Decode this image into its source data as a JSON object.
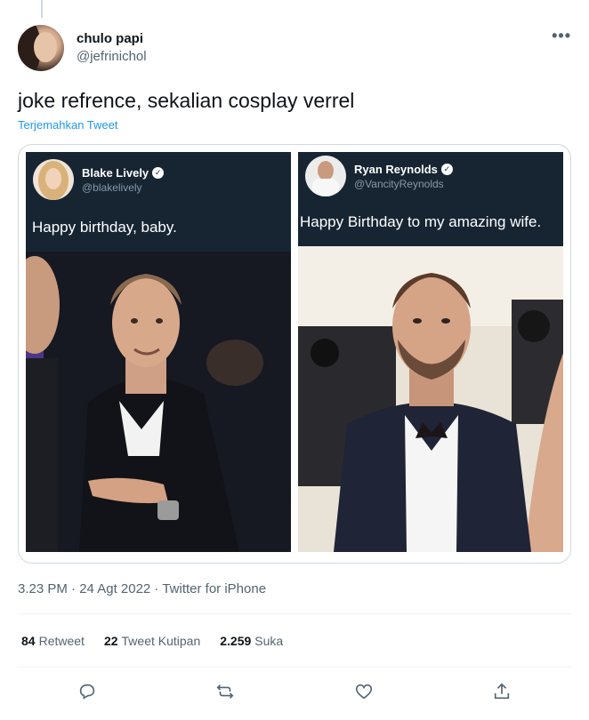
{
  "tweet": {
    "author": {
      "display_name": "chulo papi",
      "handle": "@jefrinichol"
    },
    "text": "joke refrence, sekalian cosplay verrel",
    "translate_label": "Terjemahkan Tweet",
    "more_icon": "more-icon",
    "timestamp": "3.23 PM · 24 Agt 2022 · Twitter for iPhone"
  },
  "media": {
    "left": {
      "name": "Blake Lively",
      "handle": "@blakelively",
      "body": "Happy birthday, baby."
    },
    "right": {
      "name": "Ryan Reynolds",
      "handle": "@VancityReynolds",
      "body": "Happy Birthday to my amazing wife."
    }
  },
  "stats": {
    "retweets_count": "84",
    "retweets_label": "Retweet",
    "quotes_count": "22",
    "quotes_label": "Tweet Kutipan",
    "likes_count": "2.259",
    "likes_label": "Suka"
  },
  "actions": [
    "reply-icon",
    "retweet-icon",
    "like-icon",
    "share-icon"
  ],
  "colors": {
    "link": "#1d9bf0",
    "secondary_text": "#536471",
    "dark_card": "#172533"
  }
}
